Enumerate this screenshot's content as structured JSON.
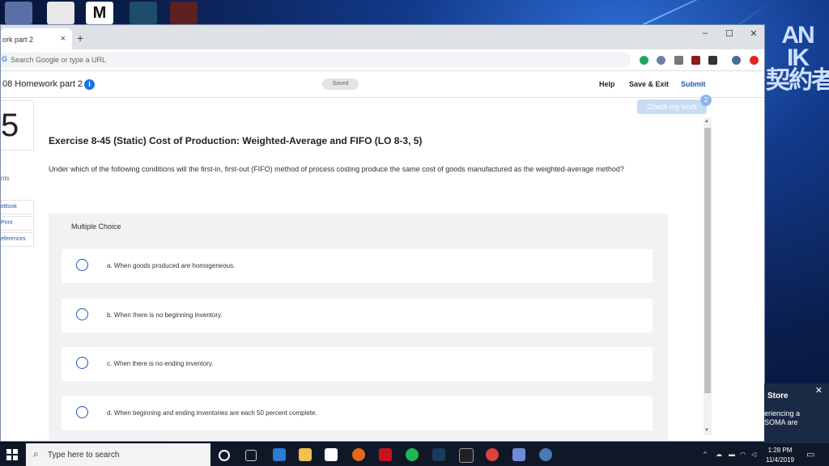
{
  "browser": {
    "tab_title": "ork part 2",
    "tab_close": "×",
    "new_tab": "+",
    "address_placeholder": "Search Google or type a URL",
    "window_controls": [
      "–",
      "☐",
      "✕"
    ]
  },
  "page": {
    "title": "08 Homework part 2",
    "info": "i",
    "saved": "Saved",
    "help": "Help",
    "save_exit": "Save & Exit",
    "submit": "Submit",
    "check_my_work": "Check my work",
    "check_badge": "2"
  },
  "question": {
    "number": "5",
    "points_label": "nts",
    "side_links": [
      "eBook",
      "Print",
      "eferences"
    ],
    "title": "Exercise 8-45 (Static) Cost of Production: Weighted-Average and FIFO (LO 8-3, 5)",
    "text": "Under which of the following conditions will the first-in, first-out (FIFO) method of process costing produce the same cost of goods manufactured as the weighted-average method?",
    "mc_header": "Multiple Choice",
    "options": [
      "a. When goods produced are homogeneous.",
      "b. When there is no beginning inventory.",
      "c. When there is no ending inventory.",
      "d. When beginning and ending inventories are each 50 percent complete."
    ]
  },
  "popup": {
    "title": "Store",
    "body_line1": "eriencing a",
    "body_line2": "SOMA are",
    "close": "✕"
  },
  "desktop": {
    "side_text": "AN\nIK\n契約者"
  },
  "taskbar": {
    "search_placeholder": "Type here to search",
    "time": "1:28 PM",
    "date": "11/4/2019"
  },
  "colors": {
    "accent": "#1f57b5",
    "check_button": "#c9dcf5",
    "taskbar": "#101828"
  }
}
